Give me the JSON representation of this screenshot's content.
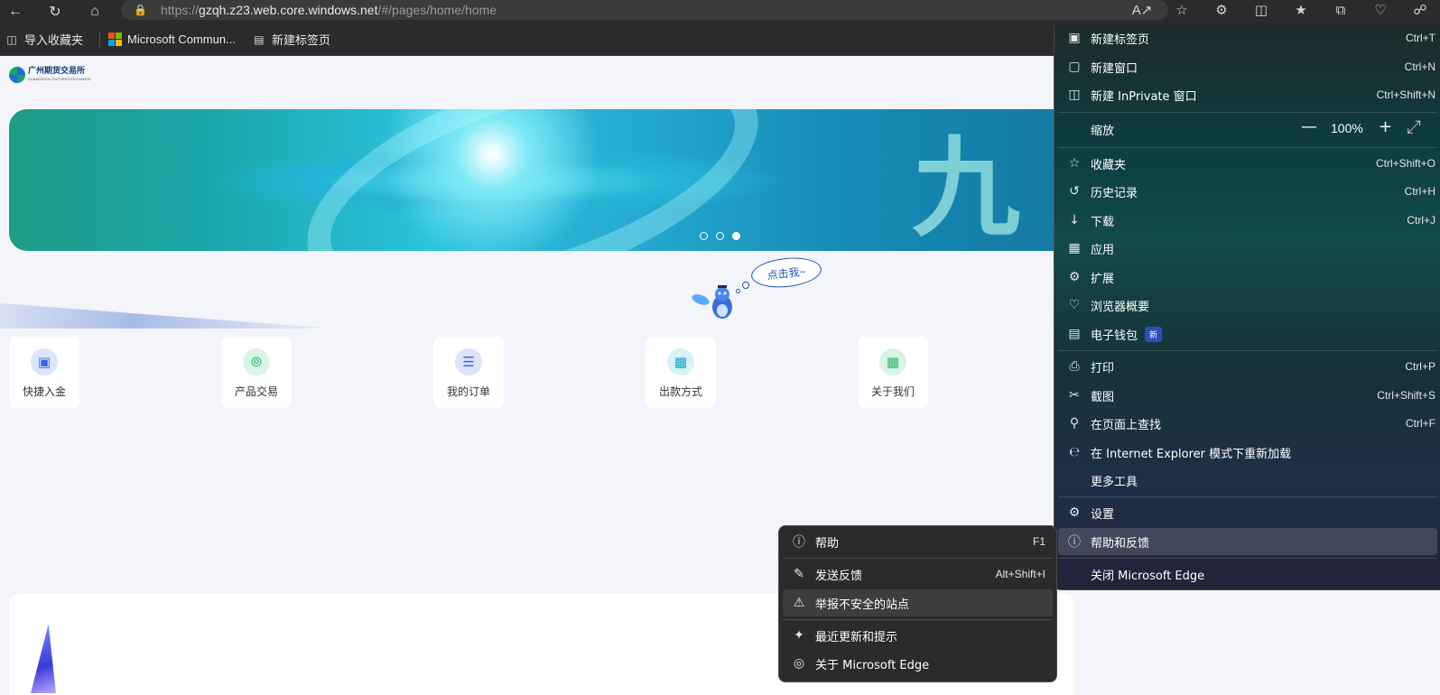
{
  "browser": {
    "url_prefix": "https://",
    "url_host": "gzqh.z23.web.core.windows.net",
    "url_path": "/#/pages/home/home",
    "favorites": [
      {
        "label": "导入收藏夹",
        "icon": "import-icon"
      },
      {
        "label": "Microsoft Commun...",
        "icon": "microsoft-logo-icon"
      },
      {
        "label": "新建标签页",
        "icon": "new-tab-icon"
      }
    ]
  },
  "page": {
    "logo_text": "广州期货交易所",
    "logo_sub": "GUANGZHOU FUTURES EXCHANGE",
    "bubble_text": "点击我~",
    "quick_actions": [
      {
        "label": "快捷入金",
        "icon": "deposit-icon",
        "color": "#2f6fe0",
        "bg": "#dbe6fb"
      },
      {
        "label": "产品交易",
        "icon": "trade-icon",
        "color": "#1db56a",
        "bg": "#d8f5e6"
      },
      {
        "label": "我的订单",
        "icon": "order-icon",
        "color": "#3a63d8",
        "bg": "#dde4fa"
      },
      {
        "label": "出款方式",
        "icon": "withdraw-icon",
        "color": "#17a9c4",
        "bg": "#d5f2f7"
      },
      {
        "label": "关于我们",
        "icon": "about-icon",
        "color": "#2fb56b",
        "bg": "#d9f3e4"
      }
    ]
  },
  "menu": {
    "items": [
      {
        "label": "新建标签页",
        "shortcut": "Ctrl+T",
        "icon": "new-tab-icon"
      },
      {
        "label": "新建窗口",
        "shortcut": "Ctrl+N",
        "icon": "new-window-icon"
      },
      {
        "label": "新建 InPrivate 窗口",
        "shortcut": "Ctrl+Shift+N",
        "icon": "inprivate-icon"
      },
      {
        "label": "缩放",
        "shortcut": "",
        "icon": ""
      },
      {
        "label": "收藏夹",
        "shortcut": "Ctrl+Shift+O",
        "icon": "favorites-icon"
      },
      {
        "label": "历史记录",
        "shortcut": "Ctrl+H",
        "icon": "history-icon"
      },
      {
        "label": "下载",
        "shortcut": "Ctrl+J",
        "icon": "download-icon"
      },
      {
        "label": "应用",
        "shortcut": "",
        "icon": "apps-icon"
      },
      {
        "label": "扩展",
        "shortcut": "",
        "icon": "extensions-icon"
      },
      {
        "label": "浏览器概要",
        "shortcut": "",
        "icon": "browser-essentials-icon"
      },
      {
        "label": "电子钱包",
        "shortcut": "",
        "icon": "wallet-icon"
      },
      {
        "label": "打印",
        "shortcut": "Ctrl+P",
        "icon": "print-icon"
      },
      {
        "label": "截图",
        "shortcut": "Ctrl+Shift+S",
        "icon": "screenshot-icon"
      },
      {
        "label": "在页面上查找",
        "shortcut": "Ctrl+F",
        "icon": "find-icon"
      },
      {
        "label": "在 Internet Explorer 模式下重新加载",
        "shortcut": "",
        "icon": "ie-mode-icon"
      },
      {
        "label": "更多工具",
        "shortcut": "",
        "icon": ""
      },
      {
        "label": "设置",
        "shortcut": "",
        "icon": "settings-icon"
      },
      {
        "label": "帮助和反馈",
        "shortcut": "",
        "icon": "help-icon"
      },
      {
        "label": "关闭 Microsoft Edge",
        "shortcut": "",
        "icon": ""
      }
    ],
    "zoom_value": "100%",
    "wallet_badge": "新"
  },
  "submenu": {
    "items": [
      {
        "label": "帮助",
        "shortcut": "F1",
        "icon": "help-icon"
      },
      {
        "label": "发送反馈",
        "shortcut": "Alt+Shift+I",
        "icon": "feedback-icon"
      },
      {
        "label": "举报不安全的站点",
        "shortcut": "",
        "icon": "warning-icon"
      },
      {
        "label": "最近更新和提示",
        "shortcut": "",
        "icon": "whats-new-icon"
      },
      {
        "label": "关于 Microsoft Edge",
        "shortcut": "",
        "icon": "edge-logo-icon"
      }
    ]
  }
}
